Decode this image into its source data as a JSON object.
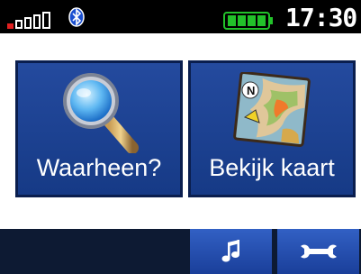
{
  "status_bar": {
    "clock": "17:30",
    "signal_icon": "signal-strength-icon",
    "bluetooth_icon": "bluetooth-icon",
    "battery_icon": "battery-full-icon",
    "battery_level": 1.0
  },
  "menu": {
    "where_to_label": "Waarheen?",
    "where_to_icon": "magnifying-glass-icon",
    "view_map_label": "Bekijk kaart",
    "view_map_icon": "map-icon"
  },
  "bottom_bar": {
    "music_icon": "music-note-icon",
    "tools_icon": "wrench-icon"
  },
  "colors": {
    "tile_blue": "#244a9e",
    "signal_red": "#e02020",
    "battery_green": "#22c22a",
    "status_bg": "#000000"
  }
}
